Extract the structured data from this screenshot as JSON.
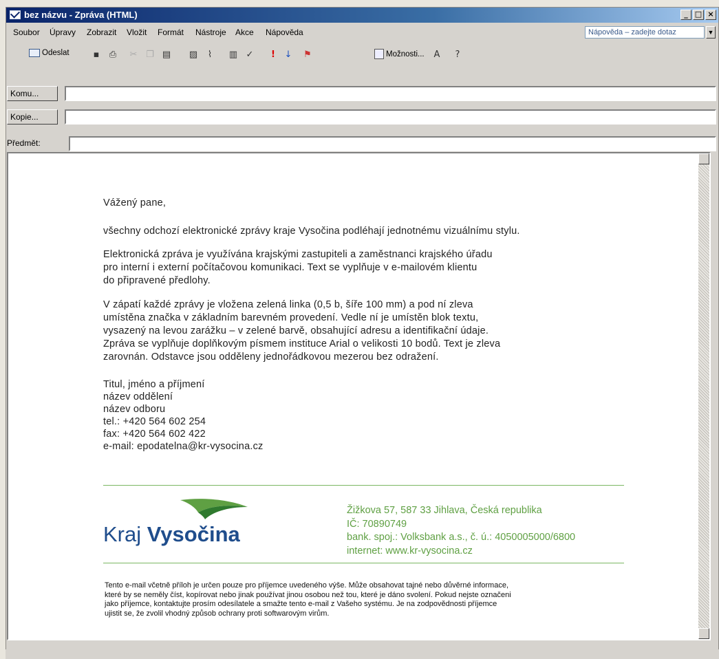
{
  "window": {
    "title": "bez názvu - Zpráva (HTML)"
  },
  "menu": [
    "Soubor",
    "Úpravy",
    "Zobrazit",
    "Vložit",
    "Formát",
    "Nástroje",
    "Akce",
    "Nápověda"
  ],
  "help_box": {
    "placeholder": "Nápověda – zadejte dotaz"
  },
  "toolbar": {
    "send_label": "Odeslat",
    "options_label": "Možnosti..."
  },
  "header_fields": {
    "to_label": "Komu...",
    "cc_label": "Kopie...",
    "subject_label": "Předmět:",
    "to_value": "",
    "cc_value": "",
    "subject_value": ""
  },
  "message": {
    "greeting": "Vážený pane,",
    "p1": "všechny odchozí elektronické zprávy kraje Vysočina podléhají jednotnému vizuálnímu stylu.",
    "p2": [
      "Elektronická zpráva je využívána krajskými zastupiteli a zaměstnanci krajského úřadu",
      "pro interní i externí počítačovou komunikaci. Text se vyplňuje v e-mailovém klientu",
      "do připravené předlohy."
    ],
    "p3": [
      "V zápatí každé zprávy je vložena zelená linka (0,5 b, šíře 100 mm) a pod ní zleva",
      "umístěna značka v základním barevném provedení. Vedle ní je umístěn blok textu,",
      "vysazený na levou zarážku – v zelené barvě, obsahující adresu a identifikační údaje.",
      "Zpráva se vyplňuje doplňkovým písmem instituce Arial o velikosti 10 bodů. Text je zleva",
      "zarovnán. Odstavce jsou odděleny jednořádkovou mezerou bez odražení."
    ],
    "signature": [
      "Titul, jméno a příjmení",
      "název oddělení",
      "název odboru",
      "tel.: +420 564 602 254",
      "fax: +420  564 602 422",
      "e-mail: epodatelna@kr-vysocina.cz"
    ]
  },
  "footer": {
    "logo_text_light": "Kraj",
    "logo_text_bold": "Vysočina",
    "address": [
      "Žižkova 57, 587 33 Jihlava, Česká republika",
      "IČ: 70890749",
      "bank. spoj.: Volksbank a.s., č. ú.: 4050005000/6800",
      "internet: www.kr-vysocina.cz"
    ],
    "disclaimer": [
      "Tento e-mail včetně příloh je určen pouze pro příjemce uvedeného výše. Může obsahovat tajné nebo důvěrné informace,",
      "které by se neměly číst, kopírovat nebo jinak používat jinou osobou než tou, které je dáno svolení. Pokud nejste označeni",
      "jako příjemce, kontaktujte prosím odesílatele a smažte tento e-mail z Vašeho systému. Je na zodpovědnosti příjemce",
      "ujistit se, že zvolil vhodný způsob ochrany proti softwarovým virům."
    ],
    "green_color": "#5fa043",
    "brand_blue": "#1f4d8c"
  }
}
